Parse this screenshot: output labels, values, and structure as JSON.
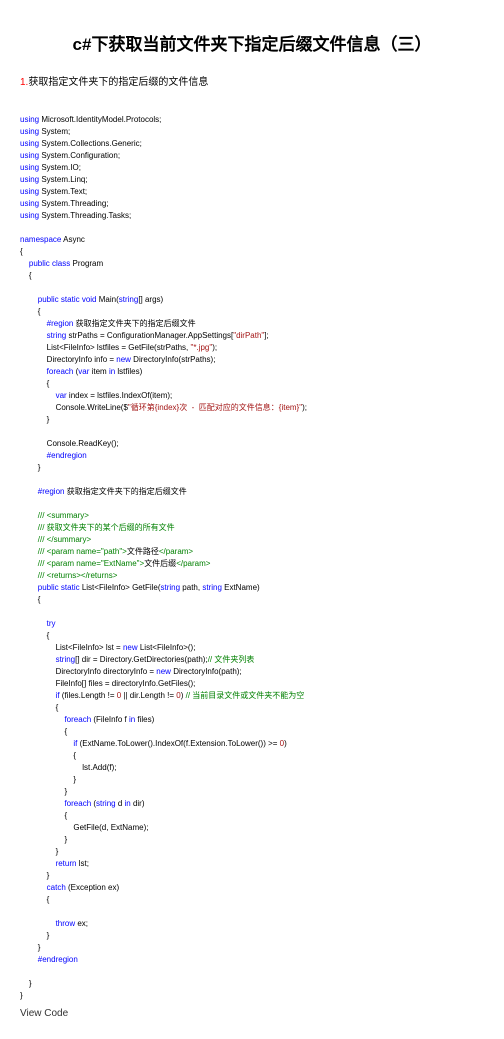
{
  "title": "c#下获取当前⽂件夹下指定后缀⽂件信息（三）",
  "num": "1.",
  "desc": "获取指定⽂件夹下的指定后缀的⽂件信息",
  "u1": "using",
  "l1": " Microsoft.IdentityModel.Protocols;",
  "l2": " System;",
  "l3": " System.Collections.Generic;",
  "l4": " System.Configuration;",
  "l5": " System.IO;",
  "l6": " System.Linq;",
  "l7": " System.Text;",
  "l8": " System.Threading;",
  "l9": " System.Threading.Tasks;",
  "ns": "namespace",
  "nsN": " Async",
  "pub": "public",
  "cls": "class",
  "clsN": " Program",
  "stat": "static",
  "void": "void",
  "main": " Main(",
  "strT": "string",
  "args": "[] args)",
  "rgn": "#region",
  "rgnC1": " 获取指定⽂件夹下的指定后缀⽂件",
  "strPaths": " strPaths = ConfigurationManager.AppSettings[",
  "dirPath": "\"dirPath\"",
  "cb": "];",
  "listLine": "            List<FileInfo> lstfiles = GetFile(strPaths, ",
  "jpg": "\"*.jpg\"",
  "diLine": "            DirectoryInfo info = ",
  "new": "new",
  "diLine2": " DirectoryInfo(strPaths);",
  "fe": "foreach",
  "feLine": " (",
  "var": "var",
  "feLine2": " item ",
  "in": "in",
  "feLine3": " lstfiles)",
  "idxLine": " index = lstfiles.IndexOf(item);",
  "cwLine": "                Console.WriteLine($",
  "cwStr": "\"循环第{index}次  -  匹配对应的⽂件信息：{item}\"",
  "readKey": "            Console.ReadKey();",
  "endrgn": "#endregion",
  "rgnC2": " 获取指定⽂件夹下的指定后缀⽂件",
  "c1": "/// <summary>",
  "c2": "/// 获取⽂件夹下的某个后缀的所有⽂件",
  "c3": "/// </summary>",
  "c4a": "/// <param name=\"path\">",
  "c4b": "⽂件路径",
  "c4c": "</param>",
  "c5a": "/// <param name=\"ExtName\">",
  "c5b": "⽂件后缀",
  "c5c": "</param>",
  "c6": "/// <returns></returns>",
  "getFile": " List<FileInfo> GetFile(",
  "getFile2": " path, ",
  "getFile3": " ExtName)",
  "try": "try",
  "lstLine": "                List<FileInfo> lst = ",
  "lstLine2": " List<FileInfo>();",
  "dirLine": "[] dir = Directory.GetDirectories(path);",
  "dirCmt": "// ⽂件夹列表",
  "diLine3": "                DirectoryInfo directoryInfo = ",
  "diLine4": " DirectoryInfo(path);",
  "filesLine": "                FileInfo[] files = directoryInfo.GetFiles();",
  "ifK": "if",
  "ifLine": " (files.Length != ",
  "zero": "0",
  "ifLine2": " || dir.Length != ",
  "ifCmt": "// 当前⽬录⽂件或⽂件夹不能为空",
  "feFLine": " (FileInfo f ",
  "feFLine2": " files)",
  "ifExt": " (ExtName.ToLower().IndexOf(f.Extension.ToLower()) >= ",
  "add": "                            lst.Add(f);",
  "feDLine": " (",
  "feDLine2": " d ",
  "feDLine3": " dir)",
  "rec": "                        GetFile(d, ExtName);",
  "ret": "return",
  "retL": " lst;",
  "catch": "catch",
  "catchL": " (Exception ex)",
  "throw": "throw",
  "throwL": " ex;",
  "caption": "View Code"
}
